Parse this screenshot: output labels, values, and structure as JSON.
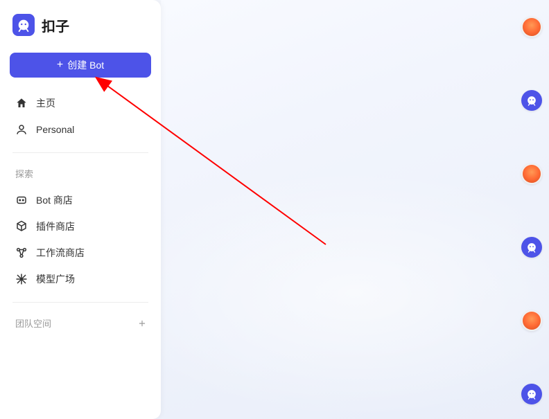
{
  "app": {
    "name": "扣子"
  },
  "sidebar": {
    "create_button": "创建 Bot",
    "nav": [
      {
        "label": "主页"
      },
      {
        "label": "Personal"
      }
    ],
    "explore": {
      "title": "探索",
      "items": [
        {
          "label": "Bot 商店"
        },
        {
          "label": "插件商店"
        },
        {
          "label": "工作流商店"
        },
        {
          "label": "模型广场"
        }
      ]
    },
    "team": {
      "title": "团队空间"
    }
  },
  "colors": {
    "primary": "#4d53e8"
  }
}
